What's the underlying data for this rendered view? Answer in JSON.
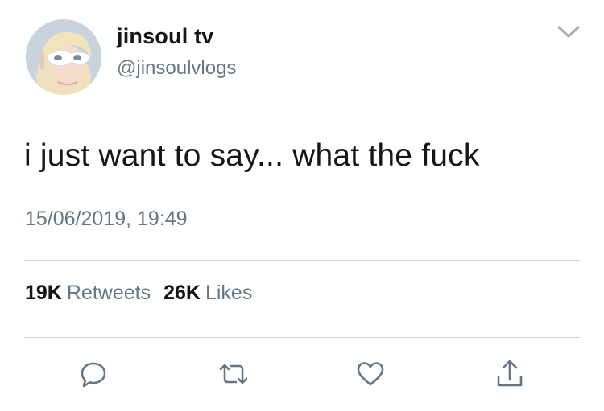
{
  "user": {
    "display_name": "jinsoul tv",
    "handle": "@jinsoulvlogs",
    "avatar_icon": "profile-photo"
  },
  "tweet": {
    "text": "i just want to say... what the fuck",
    "timestamp": "15/06/2019, 19:49"
  },
  "stats": {
    "retweets_count": "19K",
    "retweets_label": "Retweets",
    "likes_count": "26K",
    "likes_label": "Likes"
  },
  "actions": {
    "reply_icon": "speech-bubble-icon",
    "retweet_icon": "retweet-arrows-icon",
    "like_icon": "heart-outline-icon",
    "share_icon": "share-upload-icon"
  },
  "colors": {
    "text_primary": "#14171a",
    "text_secondary": "#657786",
    "icon_gray": "#657786",
    "divider": "#cfd6dc"
  }
}
